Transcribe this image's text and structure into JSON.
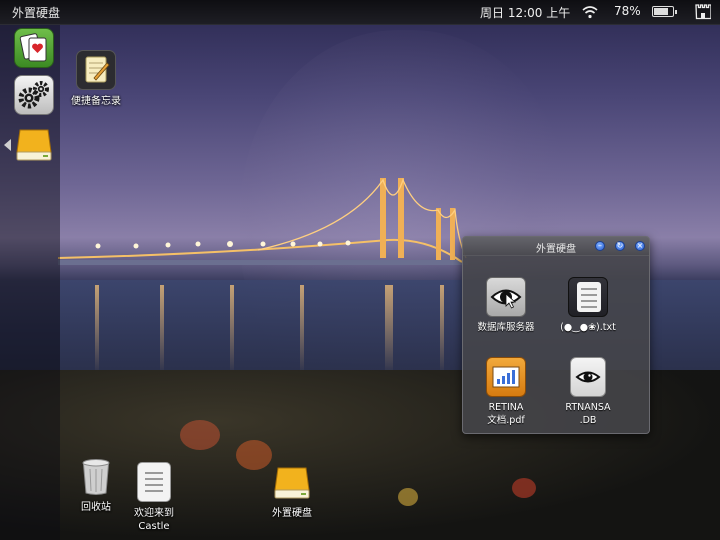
{
  "topbar": {
    "app_title": "外置硬盘",
    "clock": "周日 12:00 上午",
    "wifi_icon": "wifi-icon",
    "battery_percent": "78%",
    "battery_level": 0.78,
    "battery_icon": "battery-icon",
    "menu_icon": "castle-icon"
  },
  "dock": {
    "items": [
      {
        "icon": "solitaire-cards-icon"
      },
      {
        "icon": "settings-gears-icon"
      },
      {
        "icon": "external-drive-icon",
        "active": true
      }
    ]
  },
  "desktop": {
    "icons": [
      {
        "label": "便捷备忘录",
        "icon": "notepad-icon"
      },
      {
        "label": "回收站",
        "icon": "trash-icon"
      },
      {
        "label": "欢迎来到\nCastle",
        "label_line1": "欢迎来到",
        "label_line2": "Castle",
        "icon": "document-icon"
      },
      {
        "label": "外置硬盘",
        "icon": "external-drive-icon"
      }
    ]
  },
  "window": {
    "title": "外置硬盘",
    "controls": [
      "minimize-button",
      "maximize-button",
      "close-button"
    ],
    "items": [
      {
        "label": "数据库服务器",
        "icon": "eye-cursor-icon"
      },
      {
        "label": "(●‿●❀).txt",
        "icon": "text-file-icon"
      },
      {
        "label_line1": "RETINA",
        "label_line2": "文档.pdf",
        "icon": "pdf-chart-icon"
      },
      {
        "label_line1": "RTNANSA",
        "label_line2": ".DB",
        "icon": "database-eye-icon"
      }
    ]
  },
  "colors": {
    "accent_blue": "#2a5fd4",
    "topbar_bg": "#141418",
    "window_bg": "#46464a",
    "pdf_orange": "#e89224",
    "cards_green": "#4f9e2e"
  }
}
